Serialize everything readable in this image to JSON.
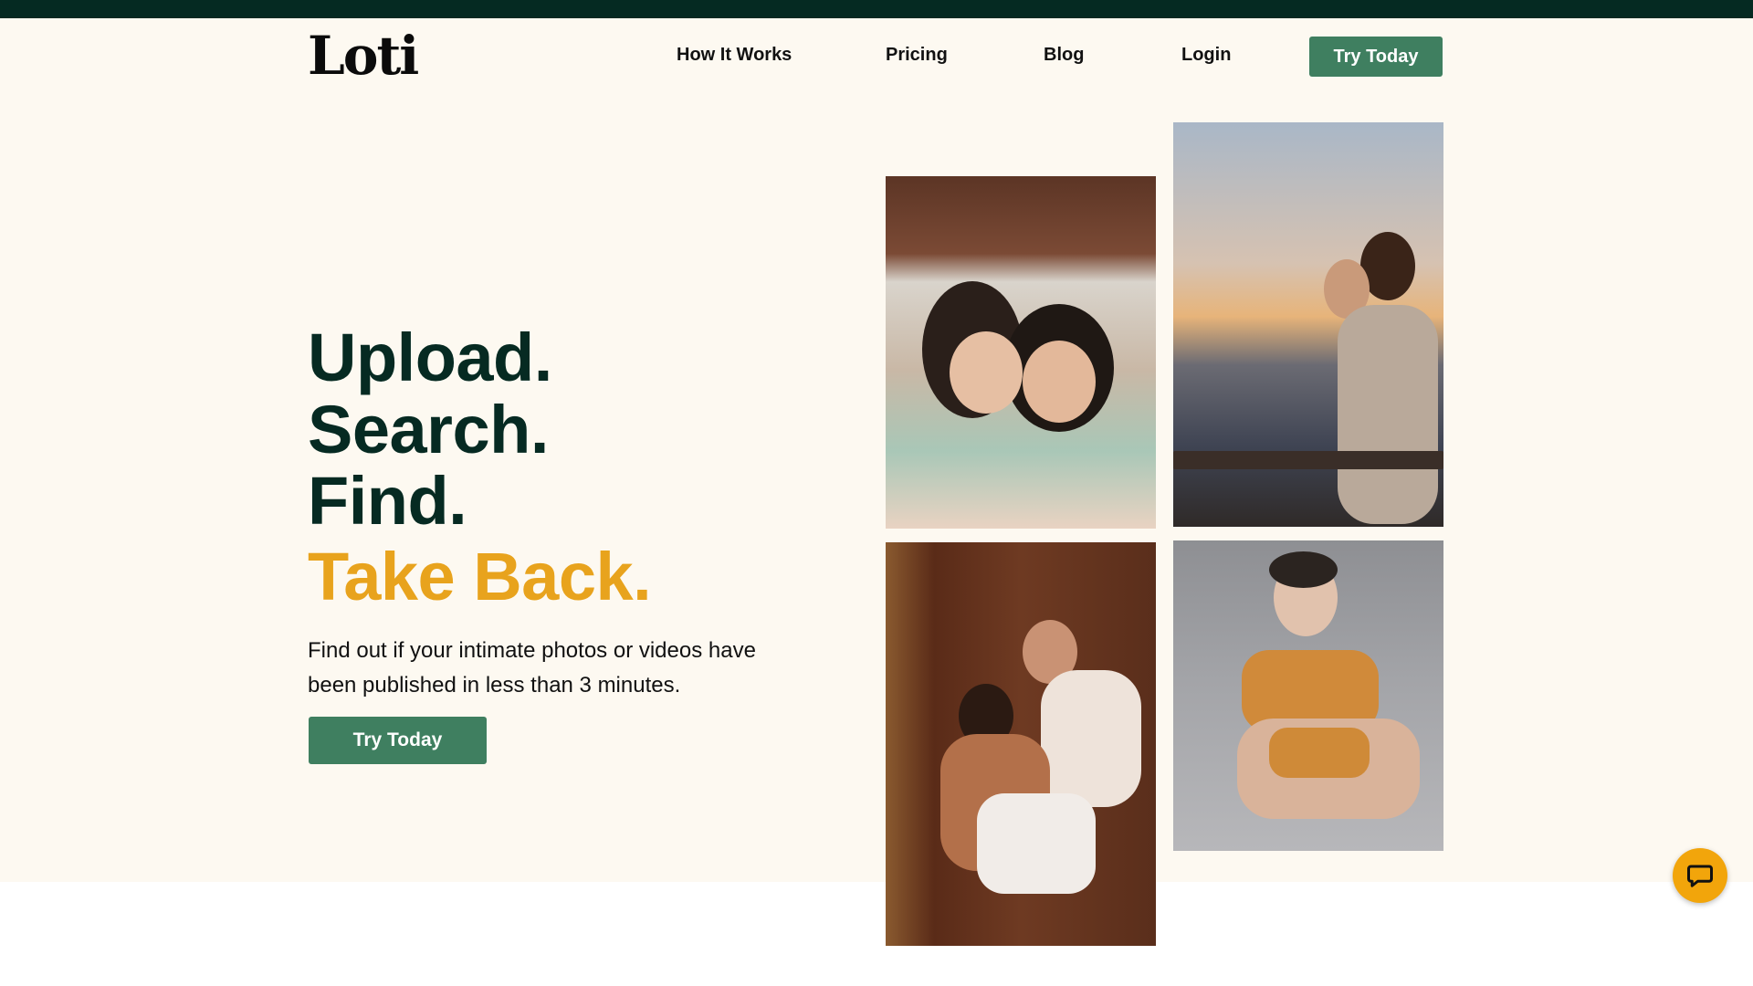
{
  "header": {
    "logo": "Loti",
    "nav": {
      "how_it_works": "How It Works",
      "pricing": "Pricing",
      "blog": "Blog",
      "login": "Login"
    },
    "cta": "Try Today"
  },
  "hero": {
    "headline": {
      "line1": "Upload.",
      "line2": "Search.",
      "line3": "Find.",
      "line4": "Take Back."
    },
    "subtext": "Find out if your intimate photos or videos have been published in less than 3 minutes.",
    "cta": "Try Today"
  },
  "colors": {
    "topbar": "#052a22",
    "hero_background": "#fdf9f1",
    "headline": "#062a22",
    "accent": "#e8a31d",
    "button": "#3f7f60",
    "chat_widget": "#f2a50b"
  },
  "icons": {
    "chat_widget": "chat-bubble-icon"
  }
}
